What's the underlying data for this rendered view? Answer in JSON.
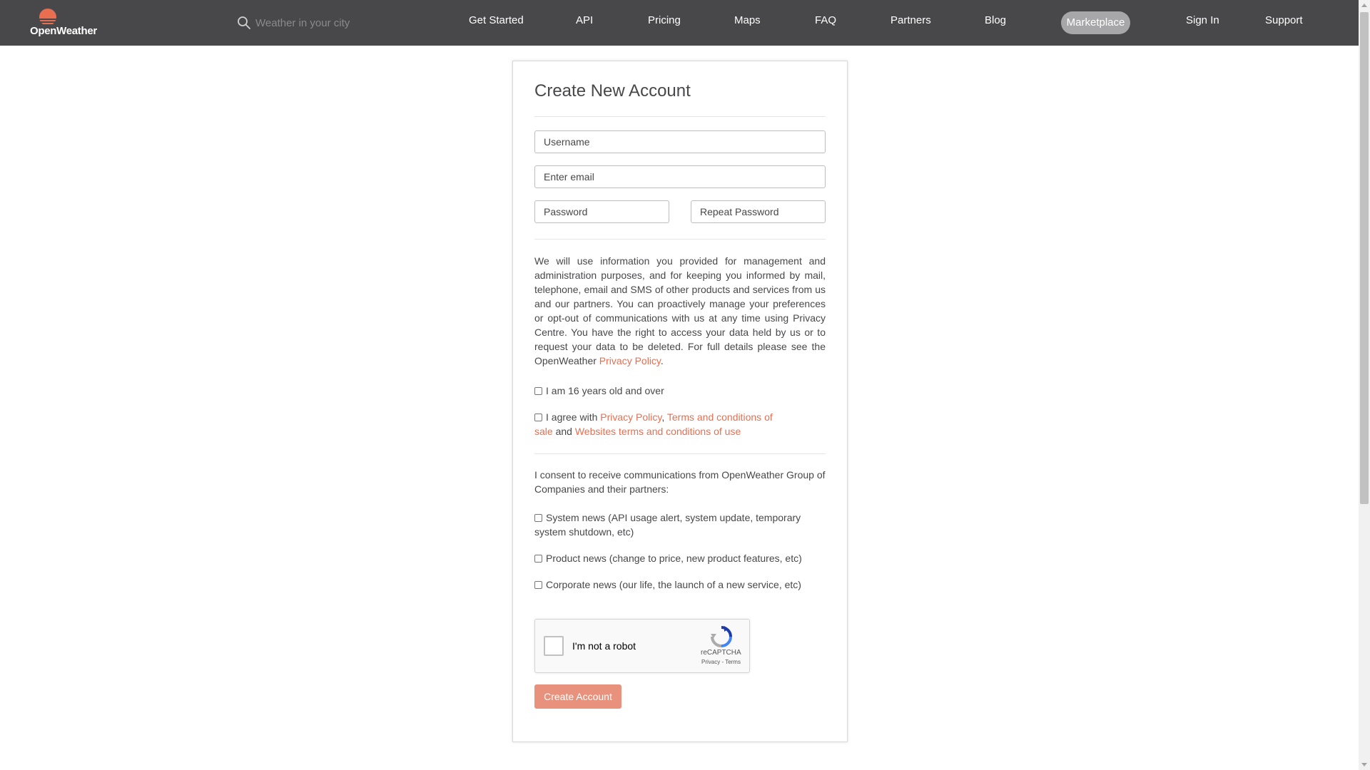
{
  "header": {
    "logo_text": "OpenWeather",
    "search_placeholder": "Weather in your city",
    "nav": [
      "Get Started",
      "API",
      "Pricing",
      "Maps",
      "FAQ",
      "Partners",
      "Blog"
    ],
    "marketplace": "Marketplace",
    "sign_in": "Sign In",
    "support": "Support"
  },
  "form": {
    "title": "Create New Account",
    "username_placeholder": "Username",
    "email_placeholder": "Enter email",
    "password_placeholder": "Password",
    "repeat_password_placeholder": "Repeat Password",
    "policy_text": "We will use information you provided for management and administration purposes, and for keeping you informed by mail, telephone, email and SMS of other products and services from us and our partners. You can proactively manage your preferences or opt-out of communications with us at any time using Privacy Centre. You have the right to access your data held by us or to request your data to be deleted. For full details please see the OpenWeather",
    "policy_link": "Privacy Policy",
    "policy_end": ".",
    "age_check": "I am 16 years old and over",
    "agree_prefix": "I agree with",
    "agree_privacy": "Privacy Policy",
    "agree_comma": ",",
    "agree_terms_sale": "Terms and conditions of sale",
    "agree_and": "and",
    "agree_web_terms": "Websites terms and conditions of use",
    "consent_text": "I consent to receive communications from OpenWeather Group of Companies and their partners:",
    "system_news": "System news (API usage alert, system update, temporary system shutdown, etc)",
    "product_news": "Product news (change to price, new product features, etc)",
    "corporate_news": "Corporate news (our life, the launch of a new service, etc)",
    "recaptcha_label": "I'm not a robot",
    "recaptcha_brand": "reCAPTCHA",
    "recaptcha_links": "Privacy - Terms",
    "submit": "Create Account"
  },
  "colors": {
    "header_bg": "#48484a",
    "accent": "#e96e50",
    "button_bg": "#e8917c"
  }
}
